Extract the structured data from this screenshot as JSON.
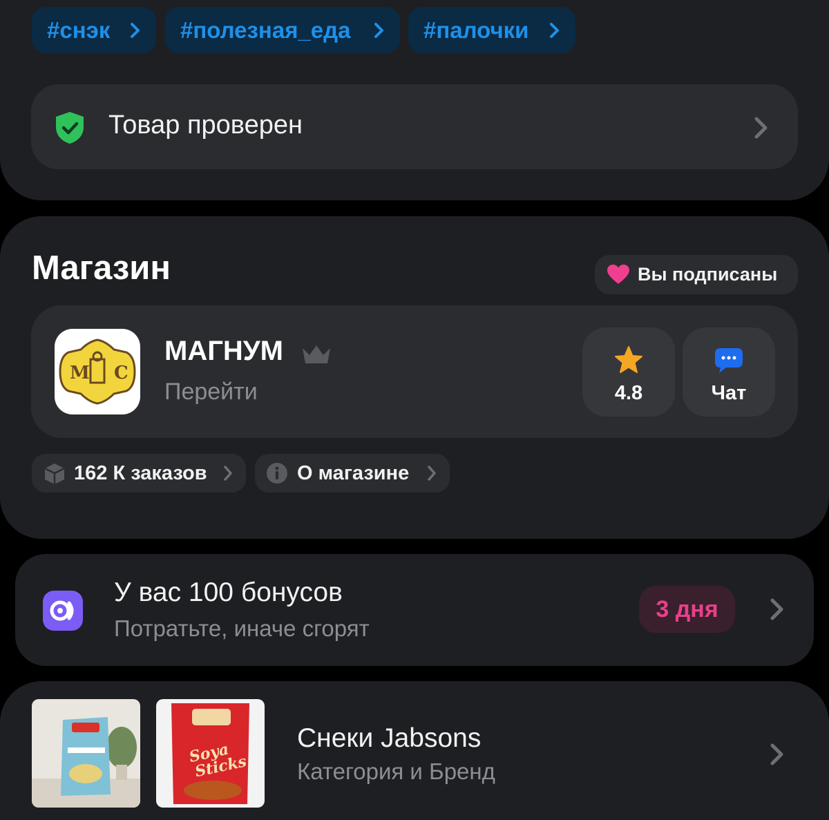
{
  "tags": [
    "#снэк",
    "#полезная_еда",
    "#палочки"
  ],
  "verified": {
    "label": "Товар проверен"
  },
  "shop": {
    "section_title": "Магазин",
    "subscribed_label": "Вы подписаны",
    "name": "МАГНУМ",
    "go_label": "Перейти",
    "rating": "4.8",
    "chat_label": "Чат",
    "orders_label": "162 К заказов",
    "about_label": "О магазине"
  },
  "bonus": {
    "title": "У вас 100 бонусов",
    "subtitle": "Потратьте, иначе сгорят",
    "days_label": "3 дня"
  },
  "brand": {
    "title": "Снеки Jabsons",
    "subtitle": "Категория и Бренд"
  },
  "colors": {
    "tag_text": "#1e90e8",
    "verified_green": "#2fc25b",
    "heart_pink": "#ef3f8f",
    "star": "#f5a623",
    "chat_blue": "#1e6cf0",
    "bonus_purple": "#7b5cf5",
    "days_pink": "#e8408a"
  },
  "icons": {
    "verified": "shield-check-icon",
    "subscribed": "heart-icon",
    "crown": "crown-icon",
    "rating": "star-icon",
    "chat": "chat-bubble-icon",
    "orders": "box-icon",
    "about": "info-icon",
    "bonus": "bonus-icon",
    "chevron": "chevron-right-icon"
  }
}
